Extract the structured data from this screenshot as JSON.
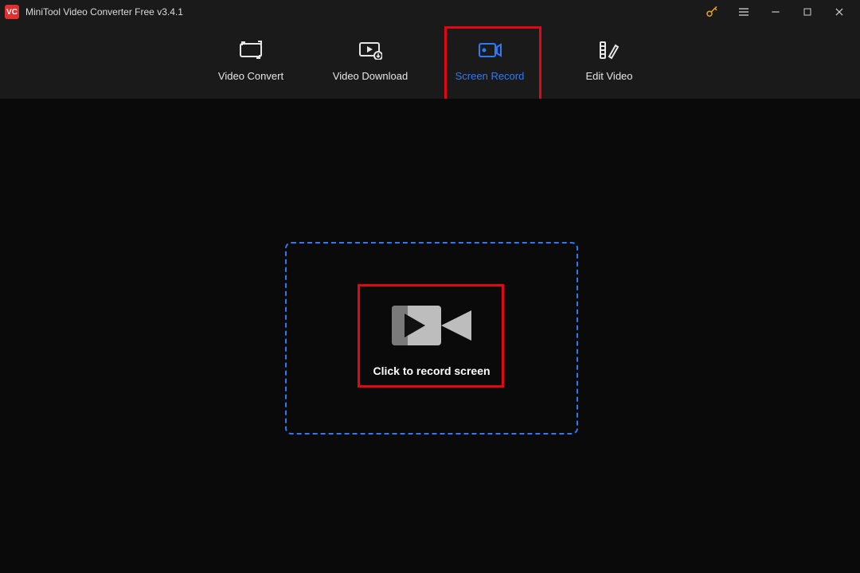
{
  "app": {
    "logo_text": "VC",
    "title": "MiniTool Video Converter Free v3.4.1"
  },
  "tabs": {
    "video_convert": "Video Convert",
    "video_download": "Video Download",
    "screen_record": "Screen Record",
    "edit_video": "Edit Video",
    "active": "screen_record"
  },
  "main": {
    "record_label": "Click to record screen"
  }
}
